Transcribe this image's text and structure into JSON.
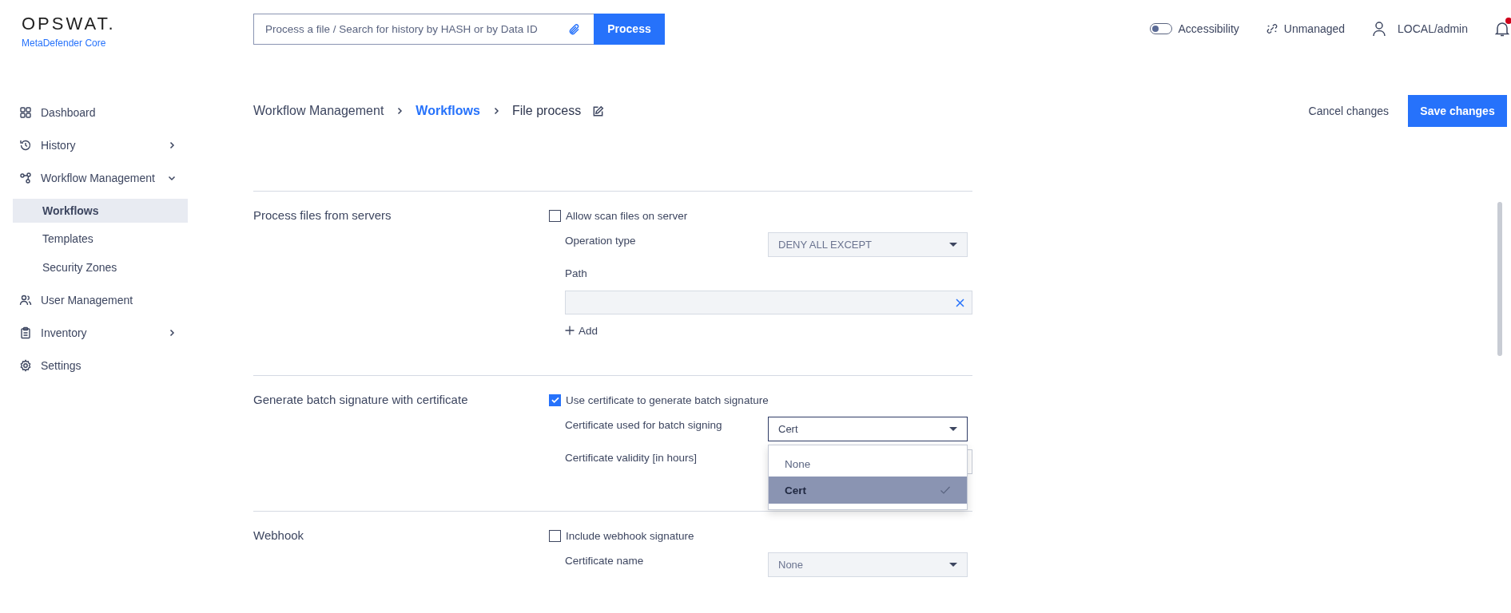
{
  "header": {
    "logo": "OPSWAT.",
    "product": "MetaDefender Core",
    "search": {
      "placeholder": "Process a file / Search for history by HASH or by Data ID"
    },
    "process_button": "Process",
    "accessibility": {
      "label": "Accessibility",
      "on": false
    },
    "unmanaged": "Unmanaged",
    "user": "LOCAL/admin",
    "notification_badge": true
  },
  "sidebar": {
    "items": [
      {
        "label": "Dashboard"
      },
      {
        "label": "History",
        "expanded": false
      },
      {
        "label": "Workflow Management",
        "expanded": true,
        "children": [
          {
            "label": "Workflows",
            "selected": true
          },
          {
            "label": "Templates",
            "selected": false
          },
          {
            "label": "Security Zones",
            "selected": false
          }
        ]
      },
      {
        "label": "User Management"
      },
      {
        "label": "Inventory",
        "expanded": false
      },
      {
        "label": "Settings"
      }
    ]
  },
  "breadcrumb": [
    {
      "label": "Workflow Management",
      "kind": "parent"
    },
    {
      "label": "Workflows",
      "kind": "link"
    },
    {
      "label": "File process",
      "kind": "current"
    }
  ],
  "actions": {
    "cancel": "Cancel changes",
    "save": "Save changes"
  },
  "sections": [
    {
      "title": "Process files from servers",
      "checkbox": {
        "label": "Allow scan files on server",
        "checked": false
      },
      "fields": [
        {
          "kind": "select",
          "label": "Operation type",
          "value": "DENY ALL EXCEPT",
          "disabled": true,
          "open": false
        },
        {
          "kind": "list",
          "label": "Path",
          "add_label": "Add"
        }
      ]
    },
    {
      "title": "Generate batch signature with certificate",
      "checkbox": {
        "label": "Use certificate to generate batch signature",
        "checked": true
      },
      "fields": [
        {
          "kind": "select",
          "label": "Certificate used for batch signing",
          "value": "Cert",
          "disabled": false,
          "open": true,
          "options": [
            {
              "label": "None",
              "selected": false
            },
            {
              "label": "Cert",
              "selected": true
            }
          ]
        },
        {
          "kind": "input",
          "label": "Certificate validity [in hours]"
        }
      ]
    },
    {
      "title": "Webhook",
      "checkbox": {
        "label": "Include webhook signature",
        "checked": false
      },
      "fields": [
        {
          "kind": "select",
          "label": "Certificate name",
          "value": "None",
          "disabled": true,
          "open": false
        }
      ]
    }
  ]
}
